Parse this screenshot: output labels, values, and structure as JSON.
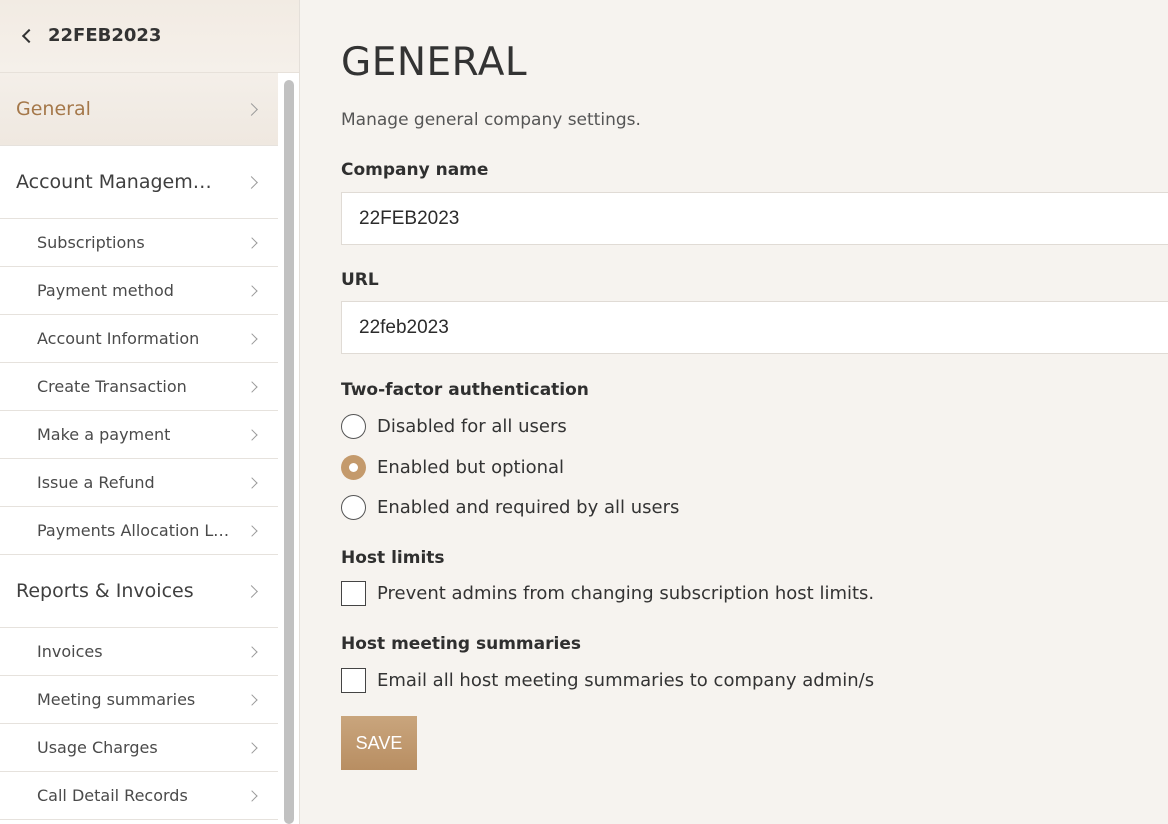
{
  "sidebar": {
    "header_label": "22FEB2023",
    "items": [
      {
        "label": "General",
        "level": "top",
        "active": true
      },
      {
        "label": "Account Management",
        "level": "top"
      },
      {
        "label": "Subscriptions",
        "level": "sub"
      },
      {
        "label": "Payment method",
        "level": "sub"
      },
      {
        "label": "Account Information",
        "level": "sub"
      },
      {
        "label": "Create Transaction",
        "level": "sub"
      },
      {
        "label": "Make a payment",
        "level": "sub"
      },
      {
        "label": "Issue a Refund",
        "level": "sub"
      },
      {
        "label": "Payments Allocation Led…",
        "level": "sub"
      },
      {
        "label": "Reports & Invoices",
        "level": "top"
      },
      {
        "label": "Invoices",
        "level": "sub"
      },
      {
        "label": "Meeting summaries",
        "level": "sub"
      },
      {
        "label": "Usage Charges",
        "level": "sub"
      },
      {
        "label": "Call Detail Records",
        "level": "sub"
      }
    ]
  },
  "main": {
    "title": "GENERAL",
    "description": "Manage general company settings.",
    "company_name": {
      "label": "Company name",
      "value": "22FEB2023"
    },
    "url": {
      "label": "URL",
      "value": "22feb2023"
    },
    "two_factor": {
      "label": "Two-factor authentication",
      "options": [
        {
          "label": "Disabled for all users",
          "checked": false
        },
        {
          "label": "Enabled but optional",
          "checked": true
        },
        {
          "label": "Enabled and required by all users",
          "checked": false
        }
      ]
    },
    "host_limits": {
      "label": "Host limits",
      "checkbox_label": "Prevent admins from changing subscription host limits.",
      "checked": false
    },
    "host_meeting_summaries": {
      "label": "Host meeting summaries",
      "checkbox_label": "Email all host meeting summaries to company admin/s",
      "checked": false
    },
    "save_label": "SAVE"
  },
  "colors": {
    "accent": "#c49a6c",
    "active_text": "#a5784a",
    "save_button": "#bd9368"
  }
}
